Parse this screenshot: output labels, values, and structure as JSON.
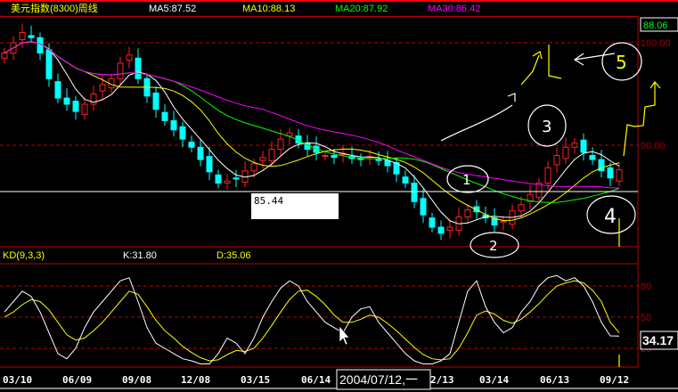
{
  "header": {
    "title": "美元指数(8300)周线",
    "ma5": "MA5:87.52",
    "ma10": "MA10:88.13",
    "ma20": "MA20:87.92",
    "ma30": "MA30:86.42"
  },
  "price_axis": {
    "current": "88.06",
    "ticks": [
      "100.00",
      "90.00"
    ]
  },
  "crosshair": {
    "price_label": "85.44",
    "date_label": "2004/07/12,一",
    "kd_value": "34.17"
  },
  "kd": {
    "title": "KD(9,3,3)",
    "k_label": "K:31.80",
    "d_label": "D:35.06",
    "ticks": [
      "80",
      "50",
      "20"
    ]
  },
  "x_axis": {
    "dates": [
      "03/10",
      "06/09",
      "09/08",
      "12/08",
      "03/15",
      "06/14",
      "2/13",
      "03/14",
      "06/13",
      "09/12"
    ]
  },
  "annotations": [
    "1",
    "2",
    "3",
    "4",
    "5"
  ],
  "colors": {
    "up": "#ff2020",
    "down": "#00ffff",
    "ma5": "#ffffff",
    "ma10": "#ffff00",
    "ma20": "#00ff00",
    "ma30": "#ff00ff",
    "grid": "#c00000"
  },
  "chart_data": {
    "type": "candlestick",
    "title": "美元指数(8300)周线",
    "ylim": [
      80.5,
      102.5
    ],
    "price_ref": 85.44,
    "closes": [
      99,
      100,
      101,
      100.5,
      99,
      96.5,
      94.6,
      94,
      93.3,
      94,
      95,
      95.9,
      96.5,
      98,
      98.8,
      96.5,
      94.8,
      93.5,
      92.4,
      91.5,
      90.6,
      89.8,
      88.6,
      87.4,
      86.3,
      86.5,
      86.7,
      87.5,
      88.2,
      88.8,
      89.6,
      90.6,
      91.2,
      90.2,
      89.6,
      89.3,
      89.0,
      88.8,
      89.2,
      88.7,
      88.6,
      88.9,
      88.5,
      88.0,
      87.2,
      86.3,
      84.5,
      83.2,
      82,
      81.4,
      82,
      83,
      83.7,
      83.5,
      82.9,
      82.2,
      82.6,
      83.6,
      84.2,
      85.2,
      86.3,
      87.8,
      89,
      89.8,
      90.2,
      89.3,
      88.6,
      87.5,
      86.8,
      87.6
    ],
    "kd": {
      "ylim": [
        0,
        100
      ],
      "K": [
        55,
        65,
        75,
        70,
        55,
        35,
        15,
        10,
        20,
        40,
        55,
        65,
        75,
        85,
        88,
        65,
        40,
        25,
        20,
        15,
        10,
        8,
        5,
        5,
        15,
        30,
        25,
        15,
        30,
        50,
        65,
        78,
        85,
        80,
        65,
        55,
        45,
        40,
        35,
        50,
        58,
        60,
        45,
        35,
        25,
        15,
        8,
        5,
        5,
        8,
        15,
        45,
        75,
        85,
        60,
        45,
        35,
        40,
        55,
        65,
        80,
        88,
        90,
        85,
        88,
        80,
        65,
        45,
        32,
        31.8
      ],
      "D": [
        50,
        55,
        62,
        67,
        65,
        57,
        45,
        33,
        28,
        30,
        37,
        45,
        55,
        65,
        75,
        72,
        60,
        47,
        37,
        30,
        22,
        16,
        11,
        8,
        9,
        14,
        18,
        17,
        20,
        30,
        42,
        55,
        67,
        75,
        76,
        70,
        62,
        52,
        45,
        45,
        48,
        52,
        50,
        44,
        37,
        29,
        21,
        14,
        10,
        9,
        10,
        20,
        35,
        52,
        56,
        53,
        47,
        44,
        48,
        55,
        63,
        72,
        80,
        83,
        85,
        83,
        76,
        65,
        45,
        35.06
      ]
    }
  }
}
